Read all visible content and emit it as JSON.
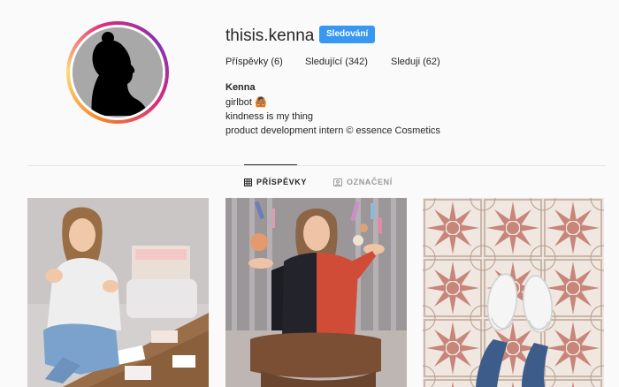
{
  "profile": {
    "username": "thisis.kenna",
    "follow_label": "Sledování",
    "stats": [
      {
        "label": "Příspěvky",
        "count": "6"
      },
      {
        "label": "Sledující",
        "count": "342"
      },
      {
        "label": "Sleduji",
        "count": "62"
      }
    ],
    "name": "Kenna",
    "bio_lines": [
      "girlbot 🙆🏽",
      "kindness is my thing",
      "product development intern © essence Cosmetics"
    ]
  },
  "tabs": [
    {
      "label": "PŘÍSPĚVKY",
      "icon": "grid-icon",
      "active": true
    },
    {
      "label": "OZNAČENÍ",
      "icon": "tagged-icon",
      "active": false
    }
  ],
  "colors": {
    "accent": "#3897f0",
    "text": "#262626",
    "muted": "#999999",
    "background": "#fafafa"
  }
}
